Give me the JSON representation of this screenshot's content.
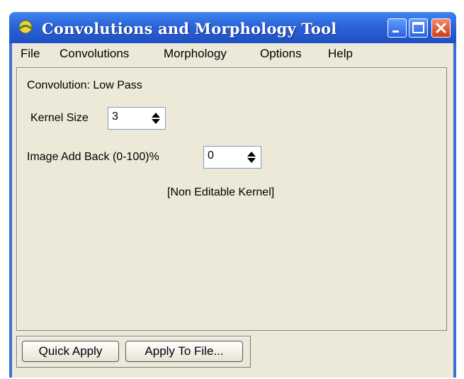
{
  "window": {
    "title": "Convolutions and Morphology Tool",
    "icon": "app-icon",
    "controls": [
      "minimize-icon",
      "maximize-icon",
      "close-icon"
    ]
  },
  "menu": {
    "items": [
      "File",
      "Convolutions",
      "Morphology",
      "Options",
      "Help"
    ]
  },
  "panel": {
    "convolution_label": "Convolution: Low Pass",
    "kernel_size_label": "Kernel Size",
    "kernel_size_value": "3",
    "add_back_label": "Image Add Back (0-100)%",
    "add_back_value": "0",
    "kernel_note": "[Non Editable Kernel]"
  },
  "buttons": {
    "quick_apply": "Quick Apply",
    "apply_to_file": "Apply To File..."
  },
  "colors": {
    "titlebar": "#2b63d8",
    "close_button": "#d23b12",
    "dialog_bg": "#ece9d8"
  }
}
